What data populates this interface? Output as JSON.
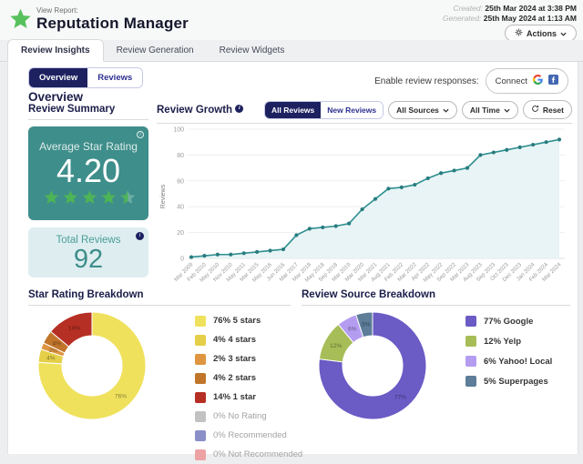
{
  "header": {
    "view_report_label": "View Report:",
    "title": "Reputation Manager",
    "created_label": "Created:",
    "created_value": "25th Mar 2024 at 3:38 PM",
    "generated_label": "Generated:",
    "generated_value": "25th May 2024 at 1:13 AM",
    "actions_label": "Actions"
  },
  "tabs": [
    {
      "label": "Review Insights",
      "active": true
    },
    {
      "label": "Review Generation",
      "active": false
    },
    {
      "label": "Review Widgets",
      "active": false
    }
  ],
  "subnav": {
    "overview_toggle": "Overview",
    "reviews_toggle": "Reviews",
    "enable_label": "Enable review responses:",
    "connect_label": "Connect"
  },
  "page_heading": "Overview",
  "summary": {
    "heading": "Review Summary",
    "average_label": "Average Star Rating",
    "average_value": "4.20",
    "stars_filled": 4.5,
    "total_label": "Total Reviews",
    "total_value": "92"
  },
  "growth": {
    "heading": "Review Growth",
    "all_reviews_label": "All Reviews",
    "new_reviews_label": "New Reviews",
    "sources_label": "All Sources",
    "time_label": "All Time",
    "reset_label": "Reset"
  },
  "breakdowns": {
    "star_heading": "Star Rating Breakdown",
    "source_heading": "Review Source Breakdown"
  },
  "colors": {
    "navy": "#1d2160",
    "teal_card": "#3e8e8b",
    "teal_light_card": "#deeef0",
    "star_green": "#4db457",
    "logo_green": "#57c15e"
  },
  "chart_data": [
    {
      "type": "line",
      "title": "Review Growth",
      "ylabel": "Reviews",
      "ylim": [
        0,
        100
      ],
      "yticks": [
        0,
        20,
        40,
        60,
        80,
        100
      ],
      "grid": true,
      "x": [
        "Mar 2009",
        "Feb 2010",
        "May 2010",
        "Nov 2010",
        "May 2011",
        "Mar 2015",
        "May 2016",
        "Jun 2016",
        "Mar 2017",
        "Mar 2018",
        "May 2018",
        "Sep 2018",
        "Mar 2019",
        "Mar 2020",
        "Mar 2021",
        "Aug 2021",
        "Feb 2022",
        "Mar 2022",
        "Apr 2022",
        "May 2022",
        "Sep 2022",
        "Mar 2023",
        "Aug 2023",
        "Sep 2023",
        "Oct 2023",
        "Dec 2023",
        "Jan 2024",
        "Feb 2024",
        "Mar 2024"
      ],
      "series": [
        {
          "name": "All Reviews",
          "values": [
            1,
            2,
            3,
            3,
            4,
            5,
            6,
            7,
            18,
            23,
            24,
            25,
            27,
            38,
            46,
            54,
            55,
            57,
            62,
            66,
            68,
            70,
            80,
            82,
            84,
            86,
            88,
            90,
            92
          ]
        }
      ],
      "line_color": "#2e8f8f",
      "fill_color": "#e8f4f5",
      "point_color": "#287c80"
    },
    {
      "type": "pie",
      "donut": true,
      "title": "Star Rating Breakdown",
      "labels": [
        "5 stars",
        "4 stars",
        "3 stars",
        "2 stars",
        "1 star",
        "No Rating",
        "Recommended",
        "Not Recommended"
      ],
      "values": [
        76,
        4,
        2,
        4,
        14,
        0,
        0,
        0
      ],
      "colors": [
        "#efe15c",
        "#e5cf48",
        "#df9540",
        "#c1752a",
        "#b62f24",
        "#c2c2c2",
        "#8a8fc7",
        "#eda3a3"
      ],
      "legend_position": "right"
    },
    {
      "type": "pie",
      "donut": true,
      "title": "Review Source Breakdown",
      "labels": [
        "Google",
        "Yelp",
        "Yahoo! Local",
        "Superpages"
      ],
      "values": [
        77,
        12,
        6,
        5
      ],
      "colors": [
        "#6a5bc5",
        "#a7bd57",
        "#b49df1",
        "#5d7d99"
      ],
      "legend_position": "right"
    }
  ]
}
